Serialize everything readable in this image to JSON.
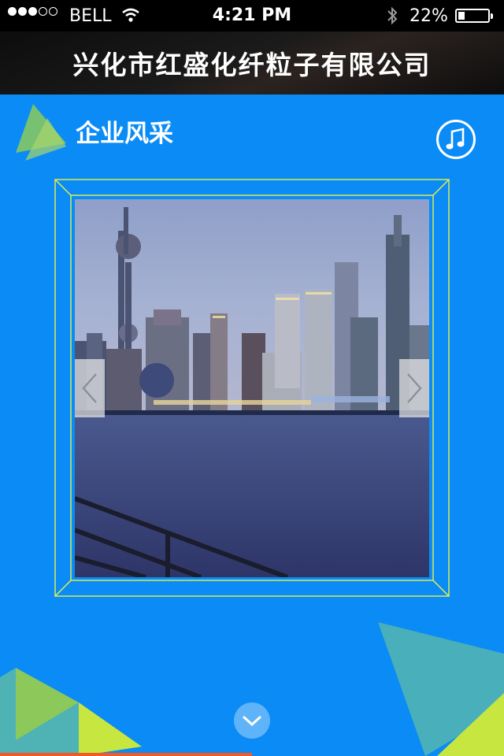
{
  "status_bar": {
    "carrier": "BELL",
    "time": "4:21 PM",
    "battery_percent_text": "22%",
    "battery_level": 0.22,
    "signal_bars_filled": 3,
    "signal_bars_total": 5
  },
  "header": {
    "title": "兴化市红盛化纤粒子有限公司"
  },
  "section": {
    "title": "企业风采"
  },
  "icons": {
    "music": "music-note-icon",
    "prev": "chevron-left-icon",
    "next": "chevron-right-icon",
    "scroll_down": "chevron-down-icon",
    "wifi": "wifi-icon",
    "bluetooth": "bluetooth-icon"
  },
  "colors": {
    "background": "#0a8bf5",
    "frame_line": "#e6f24a",
    "triangle_green": "#8cc95a",
    "triangle_teal": "#4fb3b5",
    "triangle_yellow": "#c8e640",
    "progress": "#f05a28"
  },
  "progress": 0.5
}
